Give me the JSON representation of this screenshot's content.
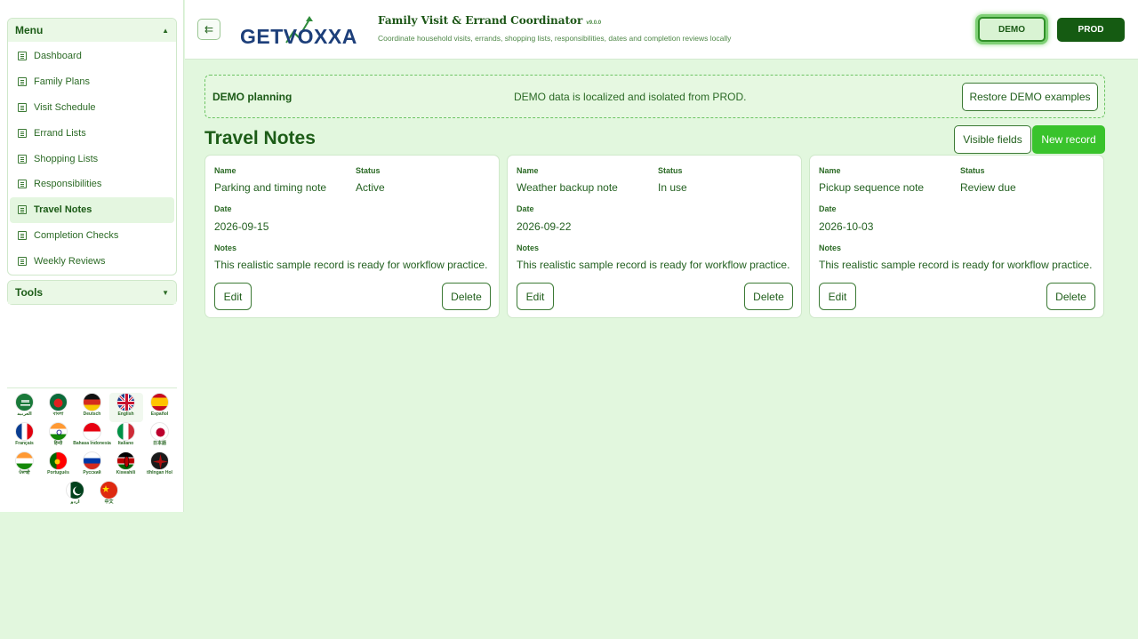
{
  "sidebar": {
    "menu_title": "Menu",
    "tools_title": "Tools",
    "items": [
      {
        "label": "Dashboard"
      },
      {
        "label": "Family Plans"
      },
      {
        "label": "Visit Schedule"
      },
      {
        "label": "Errand Lists"
      },
      {
        "label": "Shopping Lists"
      },
      {
        "label": "Responsibilities"
      },
      {
        "label": "Travel Notes"
      },
      {
        "label": "Completion Checks"
      },
      {
        "label": "Weekly Reviews"
      }
    ],
    "active_item": "Travel Notes",
    "languages": [
      {
        "label": "العربية"
      },
      {
        "label": "বাংলা"
      },
      {
        "label": "Deutsch"
      },
      {
        "label": "English"
      },
      {
        "label": "Español"
      },
      {
        "label": "Français"
      },
      {
        "label": "हिन्दी"
      },
      {
        "label": "Bahasa Indonesia"
      },
      {
        "label": "Italiano"
      },
      {
        "label": "日本語"
      },
      {
        "label": "ਪੰਜਾਬੀ"
      },
      {
        "label": "Português"
      },
      {
        "label": "Русский"
      },
      {
        "label": "Kiswahili"
      },
      {
        "label": "tlhIngan Hol"
      },
      {
        "label": "اردو"
      },
      {
        "label": "中文"
      }
    ],
    "selected_language": "English"
  },
  "header": {
    "logo_text": "GETVOXXA",
    "title": "Family Visit & Errand Coordinator",
    "version": "v9.0.0",
    "subtitle": "Coordinate household visits, errands, shopping lists, responsibilities, dates and completion reviews locally",
    "demo_label": "DEMO",
    "prod_label": "PROD"
  },
  "notice": {
    "title": "DEMO planning",
    "message": "DEMO data is localized and isolated from PROD.",
    "restore_label": "Restore DEMO examples"
  },
  "section": {
    "title": "Travel Notes",
    "visible_fields_label": "Visible fields",
    "new_record_label": "New record"
  },
  "field_labels": {
    "name": "Name",
    "status": "Status",
    "date": "Date",
    "notes": "Notes"
  },
  "records": [
    {
      "name": "Parking and timing note",
      "status": "Active",
      "date": "2026-09-15",
      "notes": "This realistic sample record is ready for workflow practice.",
      "edit": "Edit",
      "delete": "Delete"
    },
    {
      "name": "Weather backup note",
      "status": "In use",
      "date": "2026-09-22",
      "notes": "This realistic sample record is ready for workflow practice.",
      "edit": "Edit",
      "delete": "Delete"
    },
    {
      "name": "Pickup sequence note",
      "status": "Review due",
      "date": "2026-10-03",
      "notes": "This realistic sample record is ready for workflow practice.",
      "edit": "Edit",
      "delete": "Delete"
    }
  ]
}
